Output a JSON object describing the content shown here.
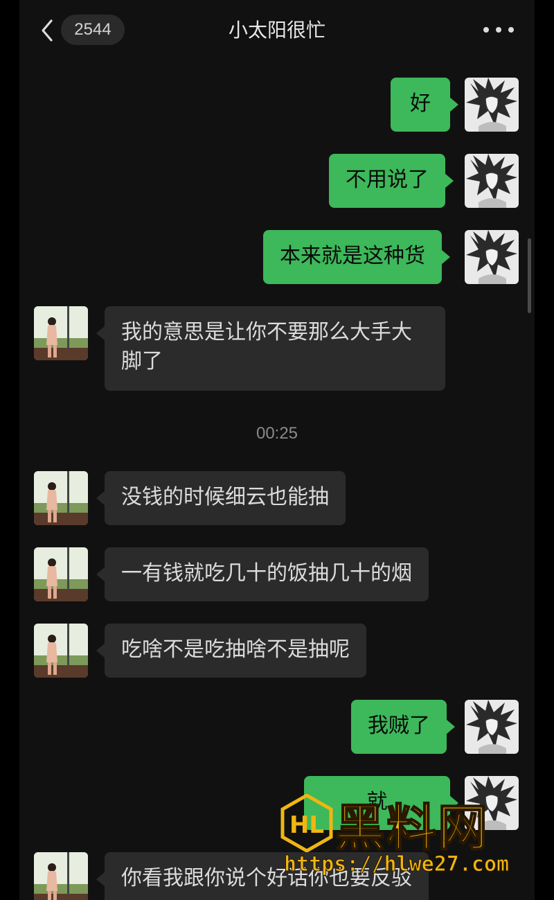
{
  "header": {
    "back_badge": "2544",
    "title": "小太阳很忙"
  },
  "messages": [
    {
      "side": "out",
      "text": "好"
    },
    {
      "side": "out",
      "text": "不用说了"
    },
    {
      "side": "out",
      "text": "本来就是这种货"
    },
    {
      "side": "in",
      "text_line1": "我的意思是让你不要那么大手大",
      "text_line2": "脚了"
    },
    {
      "timestamp": "00:25"
    },
    {
      "side": "in",
      "text": "没钱的时候细云也能抽"
    },
    {
      "side": "in",
      "text": "一有钱就吃几十的饭抽几十的烟"
    },
    {
      "side": "in",
      "text": "吃啥不是吃抽啥不是抽呢"
    },
    {
      "side": "out",
      "text": "我贼了"
    },
    {
      "side": "out",
      "text": "就"
    },
    {
      "side": "in",
      "text": "你看我跟你说个好话你也要反驳"
    }
  ],
  "watermark": {
    "brand": "黑料网",
    "url": "https://hlwe27.com"
  },
  "colors": {
    "outgoing_bubble": "#3db85a",
    "incoming_bubble": "#2b2b2b",
    "background": "#111111",
    "watermark": "#f0b612"
  }
}
